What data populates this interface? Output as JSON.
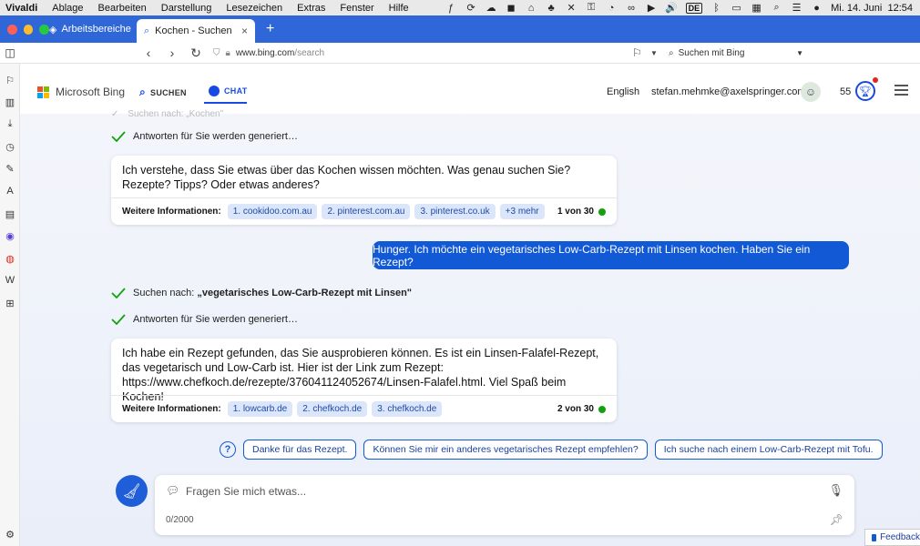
{
  "menubar": {
    "app": "Vivaldi",
    "items": [
      "Ablage",
      "Bearbeiten",
      "Darstellung",
      "Lesezeichen",
      "Extras",
      "Fenster",
      "Hilfe"
    ],
    "keyboard_layout": "DE",
    "clock": "Mi. 14. Juni  12:54"
  },
  "browser": {
    "workspace_label": "Arbeitsbereiche",
    "tab_title": "Kochen - Suchen",
    "url_host": "www.bing.com",
    "url_path": "/search",
    "search_placeholder": "Suchen mit Bing",
    "colors": {
      "tabbar": "#2f66d8",
      "close": "#fe5f57",
      "minimize": "#febc2e",
      "zoom": "#28c840"
    }
  },
  "bing": {
    "brand": "Microsoft Bing",
    "nav_search": "SUCHEN",
    "nav_chat": "CHAT",
    "language": "English",
    "user_email": "stefan.mehmke@axelspringer.com",
    "points": "55",
    "accent": "#174ae4"
  },
  "chat": {
    "faded_status": "Suchen nach: „Kochen\"",
    "status1": "Antworten für Sie werden generiert…",
    "bot1": {
      "text": "Ich verstehe, dass Sie etwas über das Kochen wissen möchten. Was genau suchen Sie? Rezepte? Tipps? Oder etwas anderes?",
      "sources_label": "Weitere Informationen:",
      "sources": [
        "1. cookidoo.com.au",
        "2. pinterest.com.au",
        "3. pinterest.co.uk",
        "+3 mehr"
      ],
      "counter": "1 von 30"
    },
    "user_message": "Hunger. Ich möchte ein vegetarisches Low-Carb-Rezept mit Linsen kochen. Haben Sie ein Rezept?",
    "status2_prefix": "Suchen nach:",
    "status2_query": "„vegetarisches Low-Carb-Rezept mit Linsen\"",
    "status3": "Antworten für Sie werden generiert…",
    "bot2": {
      "text": "Ich habe ein Rezept gefunden, das Sie ausprobieren können. Es ist ein Linsen-Falafel-Rezept, das vegetarisch und Low-Carb ist. Hier ist der Link zum Rezept: https://www.chefkoch.de/rezepte/376041124052674/Linsen-Falafel.html. Viel Spaß beim Kochen!",
      "sources_label": "Weitere Informationen:",
      "sources": [
        "1. lowcarb.de",
        "2. chefkoch.de",
        "3. chefkoch.de"
      ],
      "counter": "2 von 30"
    },
    "suggestions": [
      "Danke für das Rezept.",
      "Können Sie mir ein anderes vegetarisches Rezept empfehlen?",
      "Ich suche nach einem Low-Carb-Rezept mit Tofu."
    ],
    "input_placeholder": "Fragen Sie mich etwas...",
    "char_count": "0/2000",
    "feedback": "Feedback"
  }
}
